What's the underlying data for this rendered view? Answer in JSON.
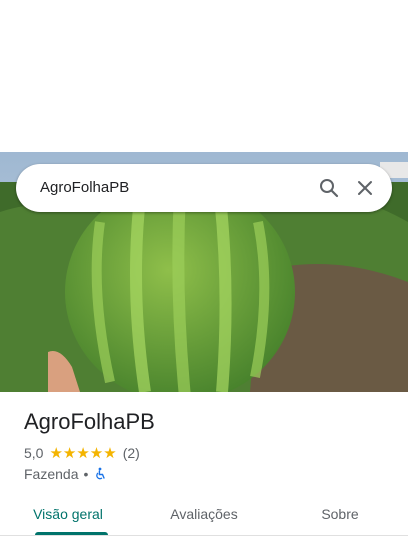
{
  "search": {
    "query": "AgroFolhaPB"
  },
  "icons": {
    "search": "search-icon",
    "close": "close-icon",
    "wheelchair": "wheelchair-icon"
  },
  "place": {
    "name": "AgroFolhaPB",
    "rating_value": "5,0",
    "stars": "★★★★★",
    "rating_stars": 5,
    "review_count": "(2)",
    "category": "Fazenda",
    "separator": "•"
  },
  "tabs": [
    {
      "label": "Visão geral",
      "active": true
    },
    {
      "label": "Avaliações",
      "active": false
    },
    {
      "label": "Sobre",
      "active": false
    }
  ],
  "colors": {
    "accent": "#00736b",
    "star": "#f4b400"
  }
}
